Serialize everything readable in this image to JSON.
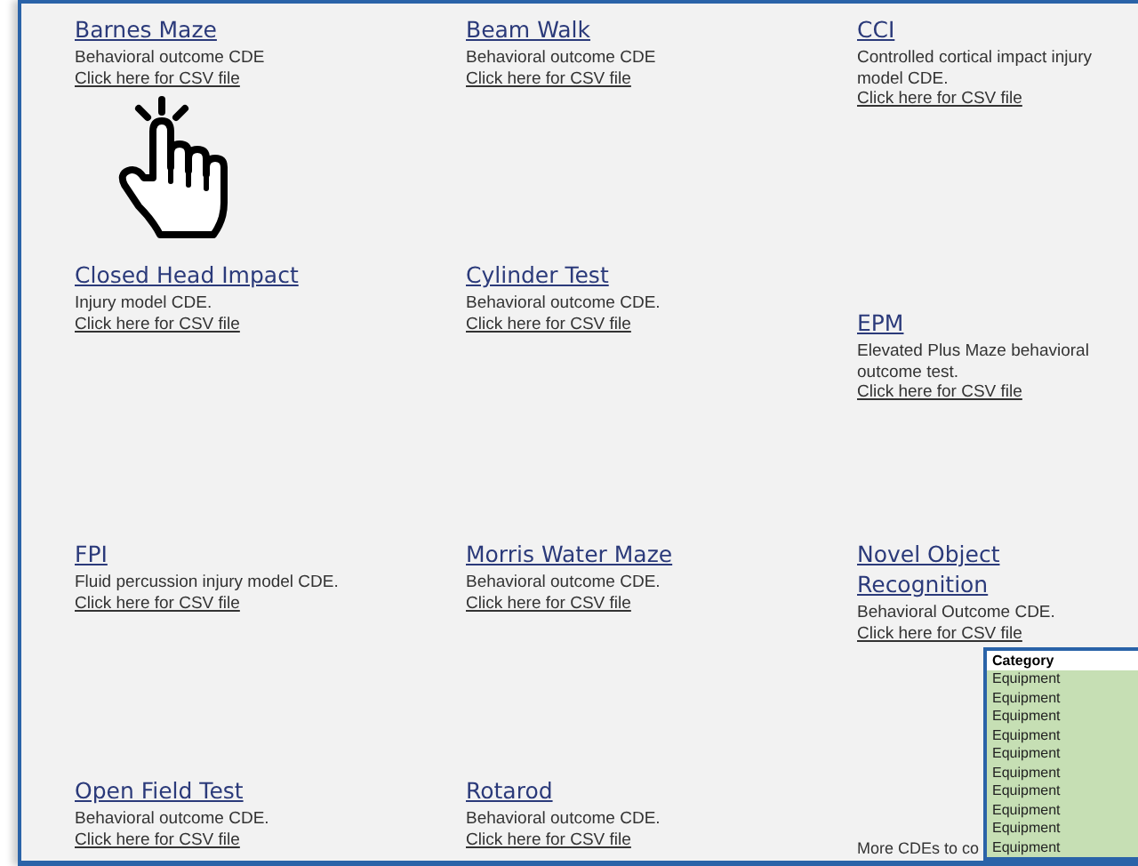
{
  "items": [
    {
      "title": "Barnes Maze",
      "description": "Behavioral outcome CDE",
      "link": "Click here for CSV file"
    },
    {
      "title": "Beam Walk",
      "description": "Behavioral outcome CDE",
      "link": "Click here for CSV file"
    },
    {
      "title": "CCI",
      "description": "Controlled cortical impact injury model CDE.",
      "link": "Click here for CSV file"
    },
    {
      "title": "Closed Head Impact",
      "description": "Injury model CDE.",
      "link": "Click here for CSV file"
    },
    {
      "title": "Cylinder Test",
      "description": "Behavioral outcome CDE.",
      "link": "Click here for CSV file"
    },
    {
      "title": "EPM",
      "description": "Elevated Plus Maze behavioral outcome test.",
      "link": "Click here for CSV file"
    },
    {
      "title": "FPI",
      "description": "Fluid percussion injury model CDE.",
      "link": "Click here for CSV file"
    },
    {
      "title": "Morris Water Maze",
      "description": "Behavioral outcome CDE.",
      "link": "Click here for CSV file"
    },
    {
      "title": "Novel Object Recognition",
      "description": "Behavioral Outcome CDE.",
      "link": "Click here for CSV file"
    },
    {
      "title": "Open Field Test",
      "description": "Behavioral outcome CDE.",
      "link": "Click here for CSV file"
    },
    {
      "title": "Rotarod",
      "description": "Behavioral outcome CDE.",
      "link": "Click here for CSV file"
    }
  ],
  "more_note": "More CDEs to co",
  "spreadsheet": {
    "header": "Category",
    "rows": [
      "Equipment",
      "Equipment",
      "Equipment",
      "Equipment",
      "Equipment",
      "Equipment",
      "Equipment",
      "Equipment",
      "Equipment",
      "Equipment"
    ]
  }
}
